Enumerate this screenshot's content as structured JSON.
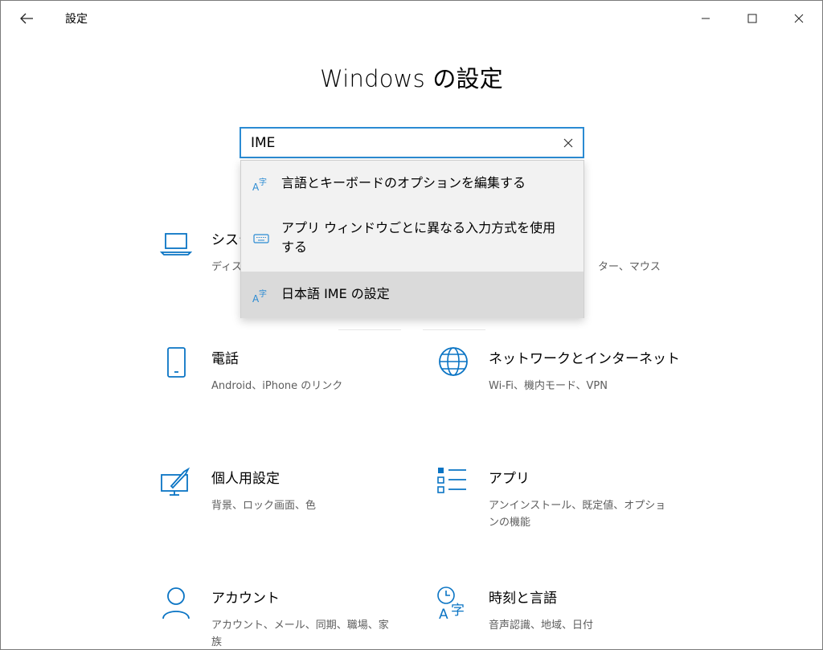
{
  "window": {
    "title": "設定",
    "controls": {
      "minimize": "minimize",
      "maximize": "maximize",
      "close": "close"
    }
  },
  "page_title": "Windows の設定",
  "search": {
    "value": "IME",
    "placeholder": ""
  },
  "suggestions": [
    {
      "icon": "language-icon",
      "label": "言語とキーボードのオプションを編集する"
    },
    {
      "icon": "keyboard-icon",
      "label": "アプリ ウィンドウごとに異なる入力方式を使用する"
    },
    {
      "icon": "language-icon",
      "label": "日本語 IME の設定",
      "hovered": true
    }
  ],
  "categories": {
    "system": {
      "icon": "laptop-icon",
      "title": "システ",
      "desc": "ディス"
    },
    "devices": {
      "icon": "devices-icon",
      "title": "",
      "desc": "ター、マウス"
    },
    "phone": {
      "icon": "phone-icon",
      "title": "電話",
      "desc": "Android、iPhone のリンク"
    },
    "network": {
      "icon": "globe-icon",
      "title": "ネットワークとインターネット",
      "desc": "Wi-Fi、機内モード、VPN"
    },
    "personalization": {
      "icon": "personalization-icon",
      "title": "個人用設定",
      "desc": "背景、ロック画面、色"
    },
    "apps": {
      "icon": "apps-icon",
      "title": "アプリ",
      "desc": "アンインストール、既定値、オプションの機能"
    },
    "accounts": {
      "icon": "person-icon",
      "title": "アカウント",
      "desc": "アカウント、メール、同期、職場、家族"
    },
    "time_language": {
      "icon": "time-language-icon",
      "title": "時刻と言語",
      "desc": "音声認識、地域、日付"
    }
  },
  "colors": {
    "accent": "#2b8bd3",
    "icon_blue": "#0a74c4",
    "hover_bg": "#dadada",
    "dropdown_bg": "#f2f2f2",
    "desc_gray": "#5d5d5d"
  }
}
